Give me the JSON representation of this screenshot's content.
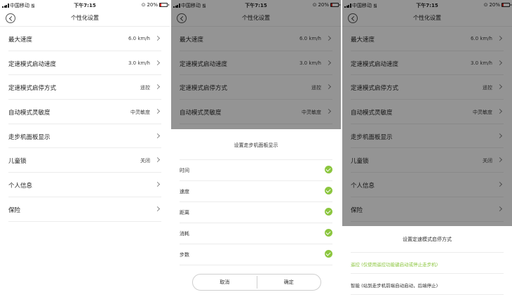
{
  "status": {
    "carrier": "中国移动",
    "time": "下午7:15",
    "battery": "20%",
    "battery_level": 0.2
  },
  "nav": {
    "title": "个性化设置"
  },
  "settings": [
    {
      "label": "最大速度",
      "value": "6.0 km/h"
    },
    {
      "label": "定速模式启动速度",
      "value": "3.0 km/h"
    },
    {
      "label": "定速模式启停方式",
      "value": "遥控"
    },
    {
      "label": "自动模式灵敏度",
      "value": "中灵敏度"
    },
    {
      "label": "走步机面板显示",
      "value": ""
    },
    {
      "label": "儿童锁",
      "value": "关闭"
    },
    {
      "label": "个人信息",
      "value": ""
    },
    {
      "label": "保险",
      "value": ""
    }
  ],
  "panel_dialog": {
    "title": "设置走步机面板显示",
    "options": [
      "时间",
      "速度",
      "距离",
      "消耗",
      "步数"
    ],
    "cancel": "取消",
    "confirm": "确定"
  },
  "mode_sheet": {
    "title": "设置定速模式启停方式",
    "options": [
      {
        "label": "遥控 (仅使用遥控功能键启动或停止走步机)",
        "selected": true
      },
      {
        "label": "智能 (站到走步机前端自动启动，后端停止)",
        "selected": false
      }
    ]
  },
  "colors": {
    "accent": "#8cc63f",
    "battery_low": "#e5342f"
  }
}
